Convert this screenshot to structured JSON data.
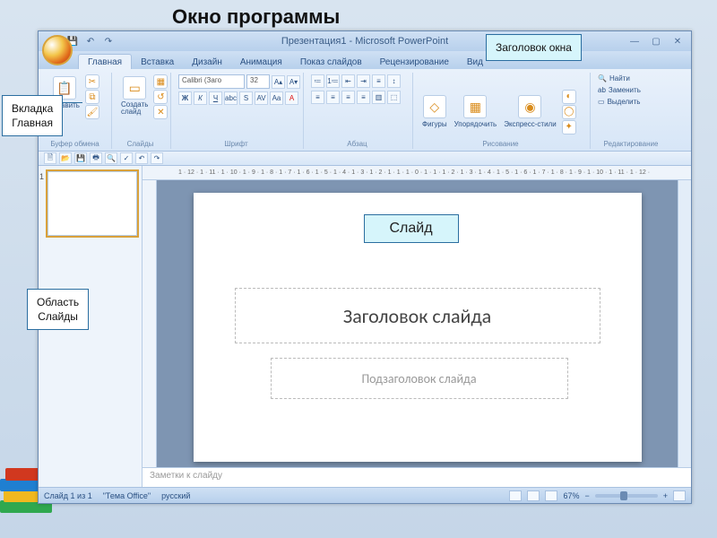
{
  "page_title": "Окно программы",
  "callouts": {
    "title_bar": "Заголовок окна",
    "tab_home": "Вкладка\nГлавная",
    "slides_pane": "Область\nСлайды",
    "slide": "Слайд"
  },
  "titlebar": {
    "title": "Презентация1 - Microsoft PowerPoint"
  },
  "tabs": [
    "Главная",
    "Вставка",
    "Дизайн",
    "Анимация",
    "Показ слайдов",
    "Рецензирование",
    "Вид"
  ],
  "ribbon": {
    "clipboard": {
      "title": "Буфер обмена",
      "paste": "Вставить"
    },
    "slides": {
      "title": "Слайды",
      "new_slide": "Создать\nслайд"
    },
    "font": {
      "title": "Шрифт",
      "font_name": "Calibri (Заго",
      "font_size": "32"
    },
    "paragraph": {
      "title": "Абзац"
    },
    "drawing": {
      "title": "Рисование",
      "shapes": "Фигуры",
      "arrange": "Упорядочить",
      "styles": "Экспресс-стили"
    },
    "editing": {
      "title": "Редактирование",
      "find": "Найти",
      "replace": "Заменить",
      "select": "Выделить"
    }
  },
  "ruler": "1 · 12 · 1 · 11 · 1 · 10 · 1 · 9 · 1 · 8 · 1 · 7 · 1 · 6 · 1 · 5 · 1 · 4 · 1 · 3 · 1 · 2 · 1 · 1 · 1 · 0 · 1 · 1 · 1 · 2 · 1 · 3 · 1 · 4 · 1 · 5 · 1 · 6 · 1 · 7 · 1 · 8 · 1 · 9 · 1 · 10 · 1 · 11 · 1 · 12 ·",
  "slide_canvas": {
    "title_placeholder": "Заголовок слайда",
    "subtitle_placeholder": "Подзаголовок слайда"
  },
  "notes_placeholder": "Заметки к слайду",
  "status": {
    "slide_info": "Слайд 1 из 1",
    "theme": "\"Тема Office\"",
    "lang": "русский",
    "zoom": "67%"
  }
}
